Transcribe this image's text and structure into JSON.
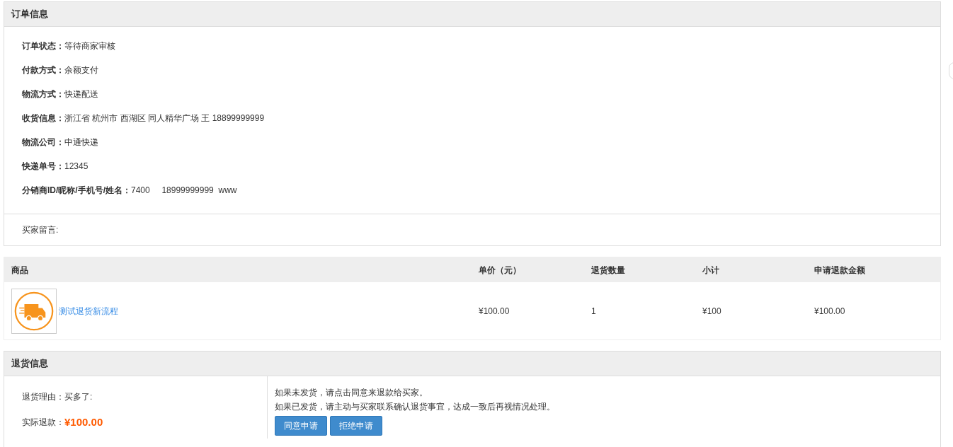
{
  "order_panel": {
    "title": "订单信息",
    "fields": [
      {
        "label": "订单状态：",
        "value": "等待商家审核"
      },
      {
        "label": "付款方式：",
        "value": "余额支付"
      },
      {
        "label": "物流方式：",
        "value": "快递配送"
      },
      {
        "label": "收货信息：",
        "value": "浙江省 杭州市 西湖区 同人精华广场 王 18899999999"
      },
      {
        "label": "物流公司：",
        "value": "中通快递"
      },
      {
        "label": "快递单号：",
        "value": "12345"
      },
      {
        "label": "分销商ID/昵称/手机号/姓名：",
        "value": "7400     18999999999  www"
      }
    ],
    "buyer_message": "买家留言:"
  },
  "goods_table": {
    "columns": [
      "商品",
      "单价（元）",
      "退货数量",
      "小计",
      "申请退款金额"
    ],
    "rows": [
      {
        "name": "测试退货新流程",
        "price": "¥100.00",
        "quantity": "1",
        "subtotal": "¥100",
        "refund": "¥100.00"
      }
    ]
  },
  "return_panel": {
    "title": "退货信息",
    "reason_label": "退货理由：",
    "reason": "买多了:",
    "refund_label": "实际退款：",
    "refund": "¥100.00",
    "notes": [
      "如果未发货，请点击同意来退款给买家。",
      "如果已发货，请主动与买家联系确认退货事宜，达成一致后再视情况处理。"
    ],
    "buttons": [
      "同意申请",
      "拒绝申请"
    ]
  }
}
